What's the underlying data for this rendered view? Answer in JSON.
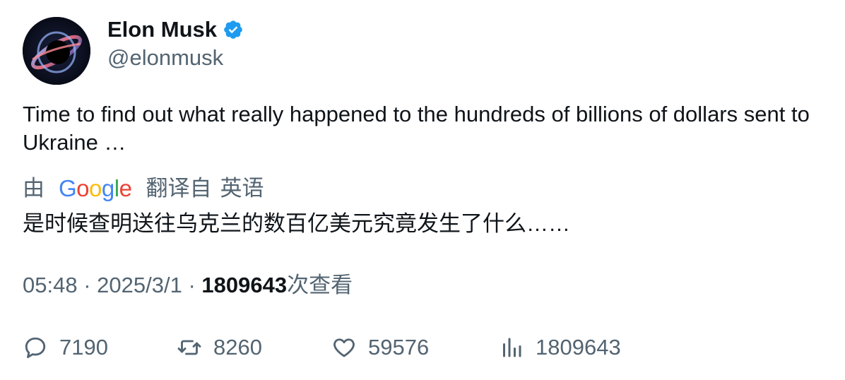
{
  "author": {
    "name": "Elon Musk",
    "handle": "@elonmusk",
    "verified_icon": "verified-badge-icon",
    "badge_color": "#1d9bf0"
  },
  "tweet": {
    "text": "Time to find out what really happened to the hundreds of billions of dollars sent to Ukraine …"
  },
  "translation": {
    "prefix": "由",
    "provider_letters": [
      "G",
      "o",
      "o",
      "g",
      "l",
      "e"
    ],
    "from_label": "翻译自",
    "language": "英语",
    "text": "是时候查明送往乌克兰的数百亿美元究竟发生了什么……"
  },
  "meta": {
    "time": "05:48",
    "separator": "·",
    "date": "2025/3/1",
    "views": "1809643",
    "views_label": "次查看"
  },
  "actions": {
    "replies": "7190",
    "retweets": "8260",
    "likes": "59576",
    "views": "1809643"
  },
  "colors": {
    "text_primary": "#0f1419",
    "text_secondary": "#536471",
    "google_blue": "#4285F4",
    "google_red": "#EA4335",
    "google_yellow": "#FBBC05",
    "google_green": "#34A853"
  }
}
